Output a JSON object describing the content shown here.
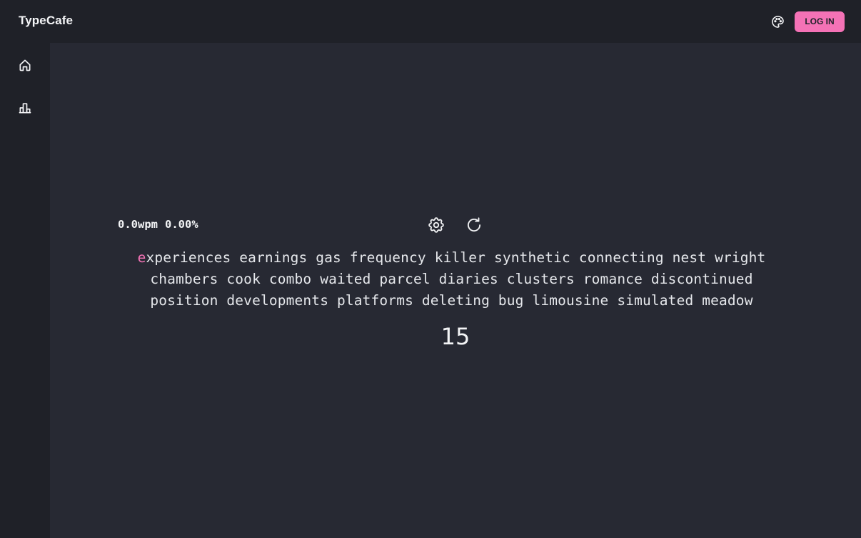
{
  "app": {
    "title": "TypeCafe"
  },
  "header": {
    "theme_icon": "palette-icon",
    "login_label": "LOG IN"
  },
  "sidebar": {
    "items": [
      {
        "icon": "home-icon",
        "label": "Home"
      },
      {
        "icon": "leaderboard-icon",
        "label": "Leaderboard"
      }
    ]
  },
  "stats": {
    "wpm_value": "0.0",
    "wpm_unit": "wpm",
    "accuracy_value": "0.00",
    "accuracy_unit": "%"
  },
  "toolbar": {
    "settings_icon": "gear-icon",
    "restart_icon": "restart-icon"
  },
  "test": {
    "current_char": "e",
    "line1_rest": "xperiences earnings gas frequency killer synthetic connecting nest wright",
    "line2": "chambers cook combo waited parcel diaries clusters romance discontinued",
    "line3": "position developments platforms deleting bug limousine simulated meadow",
    "timer": "15"
  },
  "colors": {
    "background": "#272933",
    "bar": "#1f2128",
    "accent": "#f472b6",
    "text": "#e5e7eb"
  }
}
